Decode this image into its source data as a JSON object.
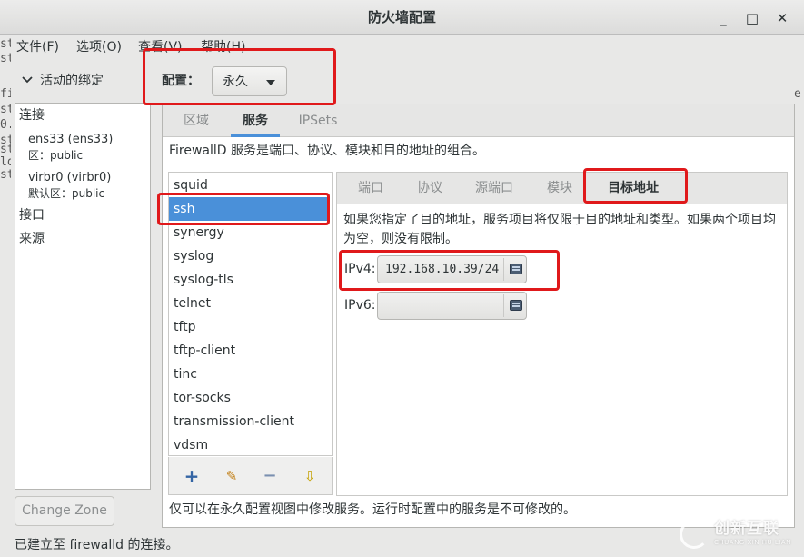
{
  "window": {
    "title": "防火墙配置",
    "minimize_glyph": "_",
    "maximize_glyph": "□",
    "close_glyph": "✕"
  },
  "menu": {
    "file": "文件(F)",
    "options": "选项(O)",
    "view": "查看(V)",
    "help": "帮助(H)"
  },
  "terminal_fragments": [
    "st",
    "st",
    "fi",
    "st",
    "0.",
    "st",
    "st",
    "lo",
    "st"
  ],
  "terminal_right_fragment": "e",
  "left_pane": {
    "header": "活动的绑定",
    "connections_label": "连接",
    "connections": [
      {
        "name": "ens33 (ens33)",
        "zone": "区：public"
      },
      {
        "name": "virbr0 (virbr0)",
        "zone": "默认区：public"
      }
    ],
    "interfaces_label": "接口",
    "sources_label": "来源",
    "change_zone_button": "Change Zone"
  },
  "config": {
    "label": "配置：",
    "value": "永久"
  },
  "main_tabs": {
    "zones": "区域",
    "services": "服务",
    "ipsets": "IPSets",
    "active": "服务"
  },
  "services": {
    "description": "FirewallD 服务是端口、协议、模块和目的地址的组合。",
    "list": [
      "squid",
      "ssh",
      "synergy",
      "syslog",
      "syslog-tls",
      "telnet",
      "tftp",
      "tftp-client",
      "tinc",
      "tor-socks",
      "transmission-client",
      "vdsm"
    ],
    "selected": "ssh",
    "toolbar": {
      "add_glyph": "+",
      "edit_glyph": "✎",
      "remove_glyph": "−",
      "load_glyph": "⇩"
    }
  },
  "sub_tabs": {
    "ports": "端口",
    "protocols": "协议",
    "source_ports": "源端口",
    "modules": "模块",
    "destination": "目标地址",
    "active": "目标地址"
  },
  "destination": {
    "description": "如果您指定了目的地址，服务项目将仅限于目的地址和类型。如果两个项目均为空，则没有限制。",
    "ipv4_label": "IPv4:",
    "ipv4_value": "192.168.10.39/24",
    "ipv6_label": "IPv6:",
    "ipv6_value": ""
  },
  "bottom_note": "仅可以在永久配置视图中修改服务。运行时配置中的服务是不可修改的。",
  "status": "已建立至 firewalld 的连接。",
  "watermark": {
    "brand": "创新互联",
    "sub": "CHUANG XIN HU LIAN"
  },
  "colors": {
    "selection": "#4a90d9",
    "annotation_red": "#e0191b",
    "window_bg": "#e8e8e7"
  }
}
